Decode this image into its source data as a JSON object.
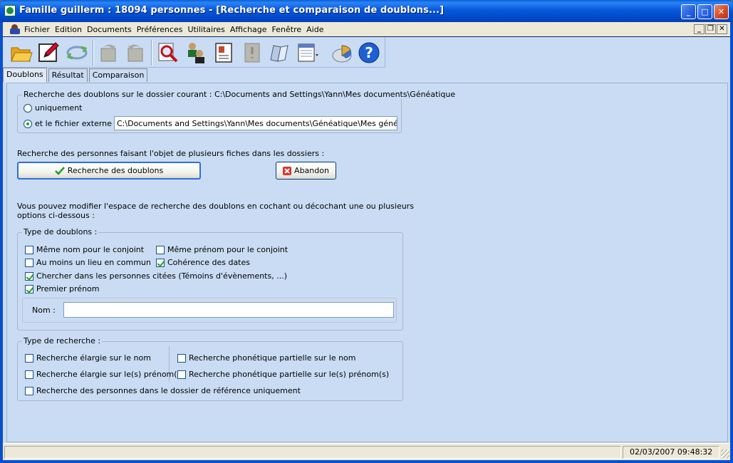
{
  "window": {
    "title": "Famille guillerm : 18094 personnes - [Recherche et comparaison de doublons...]",
    "controls": {
      "minimize": "_",
      "maximize": "□",
      "close": "✕"
    }
  },
  "menu": {
    "items": [
      "Fichier",
      "Edition",
      "Documents",
      "Préférences",
      "Utilitaires",
      "Affichage",
      "Fenêtre",
      "Aide"
    ],
    "mdi": {
      "minimize": "_",
      "restore": "❐",
      "close": "✕"
    }
  },
  "toolbar": {
    "icons": [
      "open-folder-icon",
      "edit-icon",
      "sync-icon",
      "undo-icon",
      "redo-icon",
      "search-icon",
      "persons-tree-icon",
      "record-card-icon",
      "document-icon",
      "book-icon",
      "report-icon",
      "chart-icon",
      "help-icon"
    ]
  },
  "tabs": [
    {
      "label": "Doublons",
      "active": true
    },
    {
      "label": "Résultat",
      "active": false
    },
    {
      "label": "Comparaison",
      "active": false
    }
  ],
  "current_folder": {
    "legend": "Recherche des doublons sur le dossier courant : C:\\Documents and Settings\\Yann\\Mes documents\\Généatique",
    "option_only": "uniquement",
    "option_external": "et le fichier externe :",
    "external_path": "C:\\Documents and Settings\\Yann\\Mes documents\\Généatique\\Mes généalogies\\"
  },
  "search": {
    "intro": "Recherche des personnes faisant l'objet de plusieurs fiches dans les dossiers :",
    "search_button": "Recherche des doublons",
    "abort_button": "Abandon"
  },
  "note": {
    "line1": "Vous pouvez modifier l'espace de recherche des doublons en cochant ou décochant une ou plusieurs",
    "line2": "options ci-dessous :"
  },
  "duplicate_type": {
    "legend": "Type de doublons :",
    "same_name_spouse": "Même nom pour le conjoint",
    "same_firstname_spouse": "Même prénom pour le conjoint",
    "common_place": "Au moins un lieu en commun",
    "date_consistency": "Cohérence des dates",
    "cited_persons": "Chercher dans les personnes citées (Témoins d'évènements, ...)",
    "first_firstname": "Premier prénom",
    "name_label": "Nom :",
    "name_value": ""
  },
  "search_type": {
    "legend": "Type de recherche :",
    "broad_name": "Recherche élargie sur le nom",
    "phonetic_name": "Recherche phonétique partielle sur le nom",
    "broad_firstnames": "Recherche élargie sur le(s) prénom(s)",
    "phonetic_firstnames": "Recherche phonétique partielle sur le(s) prénom(s)",
    "reference_only": "Recherche des personnes dans le dossier de référence uniquement"
  },
  "status": {
    "datetime": "02/03/2007 09:48:32"
  }
}
